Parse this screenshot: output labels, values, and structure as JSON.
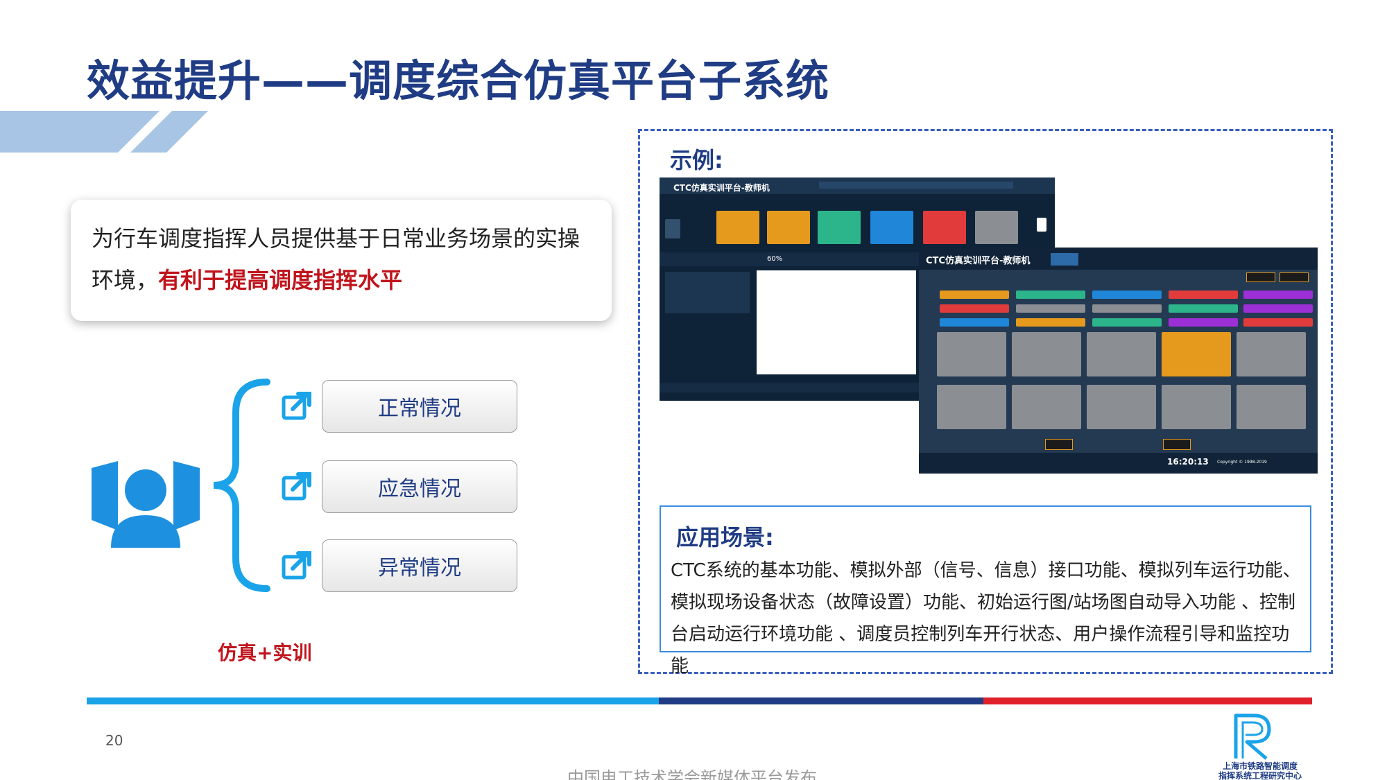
{
  "slide": {
    "title": "效益提升——调度综合仿真平台子系统",
    "page_number": "20",
    "publisher": "中国电工技术学会新媒体平台发布",
    "logo_text_line1": "上海市铁路智能调度",
    "logo_text_line2": "指挥系统工程研究中心"
  },
  "intro": {
    "text_plain": "为行车调度指挥人员提供基于日常业务场景的实操环境，",
    "text_highlight": "有利于提高调度指挥水平"
  },
  "diagram": {
    "cases": [
      "正常情况",
      "应急情况",
      "异常情况"
    ],
    "footer_label": "仿真+实训"
  },
  "example": {
    "heading": "示例:",
    "screenshot_back": {
      "app_title": "CTC仿真实训平台-教师机",
      "percent": "60%"
    },
    "screenshot_front": {
      "app_title": "CTC仿真实训平台-教师机",
      "time": "16:20:13",
      "copyright": "Copyright © 1998-2019"
    }
  },
  "scenario": {
    "heading": "应用场景:",
    "body": "CTC系统的基本功能、模拟外部（信号、信息）接口功能、模拟列车运行功能、模拟现场设备状态（故障设置）功能、初始运行图/站场图自动导入功能 、控制台启动运行环境功能 、调度员控制列车开行状态、用户操作流程引导和监控功能"
  },
  "colors": {
    "title_blue": "#1f3c84",
    "accent_red": "#c0141c",
    "icon_blue": "#1e90e0",
    "bar_light_blue": "#1aa3e8",
    "bar_dark_blue": "#1f3c84",
    "bar_red": "#e0202a"
  }
}
